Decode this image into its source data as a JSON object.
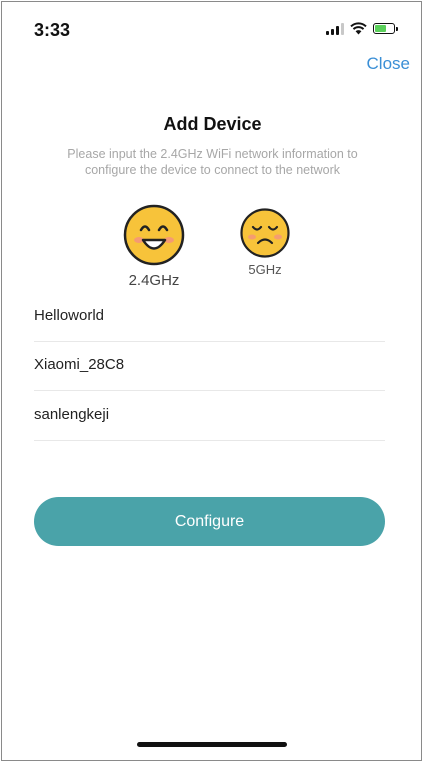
{
  "status_bar": {
    "time": "3:33"
  },
  "header": {
    "close_label": "Close"
  },
  "main": {
    "title": "Add Device",
    "subtitle": "Please input the 2.4GHz WiFi network information to configure the device to connect to the network",
    "bands": [
      {
        "label": "2.4GHz",
        "icon": "smile-face-icon"
      },
      {
        "label": "5GHz",
        "icon": "sad-face-icon"
      }
    ],
    "fields": [
      {
        "value": "Helloworld",
        "placeholder": ""
      },
      {
        "value": "Xiaomi_28C8",
        "placeholder": ""
      },
      {
        "value": "sanlengkeji",
        "placeholder": ""
      }
    ],
    "configure_label": "Configure"
  },
  "colors": {
    "accent_link": "#3a8fd6",
    "button": "#4aa3a9",
    "emoji_yellow": "#f7c33a"
  }
}
